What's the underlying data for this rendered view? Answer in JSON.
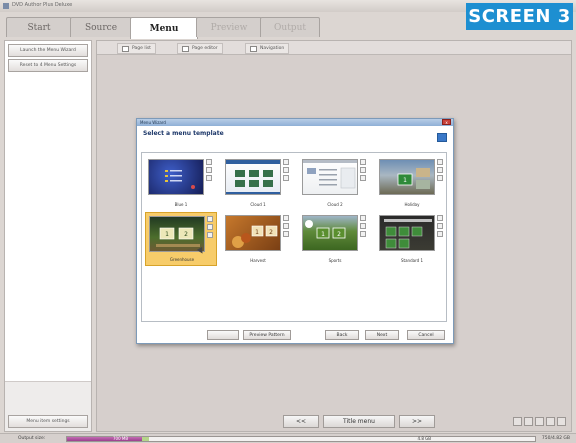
{
  "window": {
    "title": "DVD Author Plus Deluxe"
  },
  "badge": "SCREEN 3",
  "tabs": [
    {
      "label": "Start",
      "state": "normal"
    },
    {
      "label": "Source",
      "state": "normal"
    },
    {
      "label": "Menu",
      "state": "active"
    },
    {
      "label": "Preview",
      "state": "disabled"
    },
    {
      "label": "Output",
      "state": "disabled"
    }
  ],
  "left_panel": {
    "buttons": [
      "Launch the Menu Wizard",
      "Reset to 4 Menu Settings"
    ],
    "bottom_button": "Menu item settings"
  },
  "subtabs": [
    "Page list",
    "Page editor",
    "Navigation"
  ],
  "dialog": {
    "title": "Menu Wizard",
    "heading": "Select a menu template",
    "close": "x",
    "templates": [
      {
        "label": "Blue 1",
        "style": "blue"
      },
      {
        "label": "Cloud 1",
        "style": "cloud"
      },
      {
        "label": "Cloud 2",
        "style": "cloud2"
      },
      {
        "label": "Holiday",
        "style": "holiday"
      },
      {
        "label": "Greenhouse",
        "style": "greenhouse",
        "selected": true
      },
      {
        "label": "Harvest",
        "style": "harvest"
      },
      {
        "label": "Sports",
        "style": "sports"
      },
      {
        "label": "Standard 1",
        "style": "standard"
      }
    ],
    "footer": {
      "btn_blank": "",
      "preview": "Preview Pattern",
      "back": "Back",
      "next": "Next",
      "cancel": "Cancel"
    }
  },
  "nav": {
    "prev": "<<",
    "page": "Title menu",
    "next": ">>"
  },
  "status": {
    "label": "Output size:",
    "progress_text": "700 MB",
    "progress_right": "4.8 GB",
    "size": "750/4.82 GB",
    "progress_fraction": 0.16,
    "progress_secondary_fraction": 0.015
  },
  "colors": {
    "accent": "#1d8fd1",
    "selected_template": "#f7cc6a",
    "progress": "#9a3f8d"
  }
}
